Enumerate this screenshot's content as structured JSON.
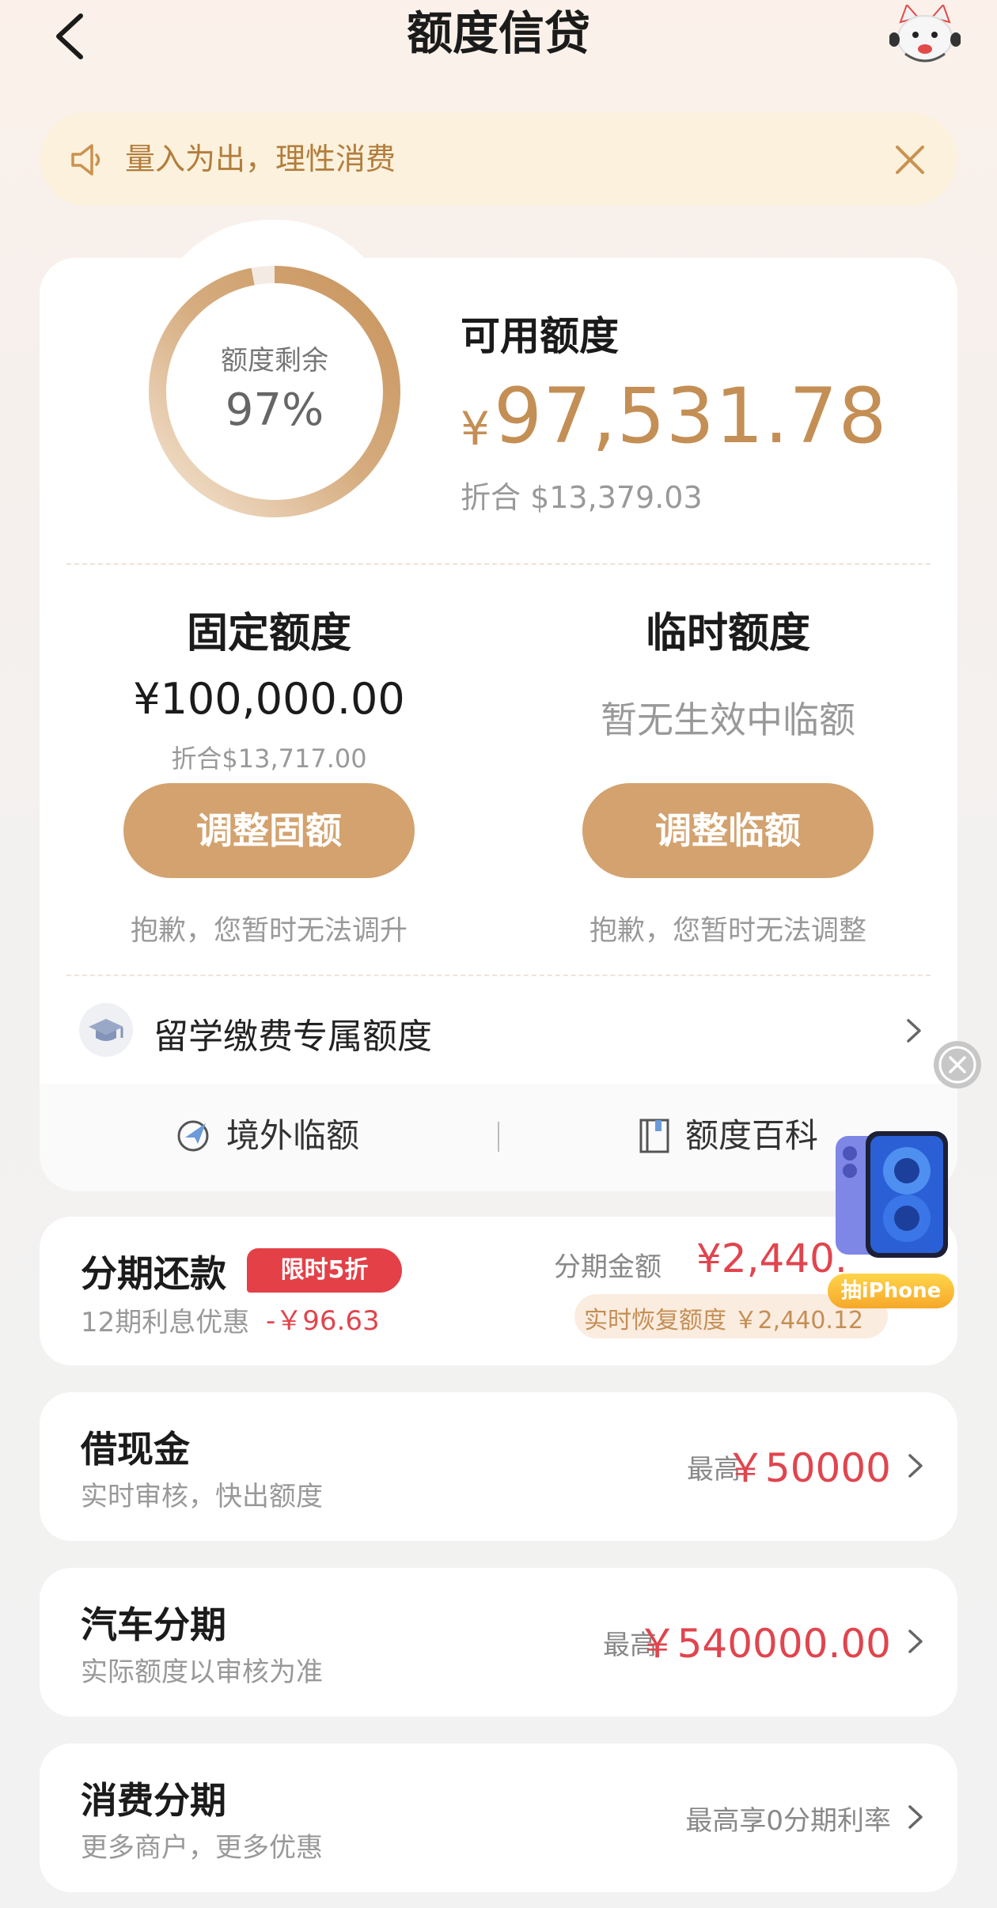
{
  "header": {
    "title": "额度信贷"
  },
  "notice": {
    "text": "量入为出，理性消费"
  },
  "summary": {
    "ring_label": "额度剩余",
    "ring_percent": "97%",
    "ring_fraction": 0.97,
    "available_label": "可用额度",
    "available_currency": "¥",
    "available_amount": "97,531.78",
    "available_equiv": "折合 $13,379.03"
  },
  "fixed": {
    "title": "固定额度",
    "amount": "¥100,000.00",
    "equiv": "折合$13,717.00",
    "button": "调整固额",
    "note": "抱歉，您暂时无法调升"
  },
  "temp": {
    "title": "临时额度",
    "status": "暂无生效中临额",
    "button": "调整临额",
    "note": "抱歉，您暂时无法调整"
  },
  "study": {
    "label": "留学缴费专属额度"
  },
  "sub_links": {
    "overseas": "境外临额",
    "encyclopedia": "额度百科"
  },
  "installment": {
    "title": "分期还款",
    "badge": "限时5折",
    "sub": "12期利息优惠",
    "discount": "-￥96.63",
    "amount_label": "分期金额",
    "amount_visible": "¥2,440.",
    "restore": "实时恢复额度 ￥2,440.12"
  },
  "promo": {
    "tag": "抽iPhone"
  },
  "cash": {
    "title": "借现金",
    "sub": "实时审核，快出额度",
    "max_label": "最高",
    "max_amount": "￥50000"
  },
  "car": {
    "title": "汽车分期",
    "sub": "实际额度以审核为准",
    "max_label": "最高",
    "max_amount": "￥540000.00"
  },
  "consumer": {
    "title": "消费分期",
    "sub": "更多商户，更多优惠",
    "right": "最高享0分期利率"
  },
  "colors": {
    "gold": "#d3a26f",
    "red": "#e0454e",
    "notice_bg": "#fbf1dd"
  }
}
